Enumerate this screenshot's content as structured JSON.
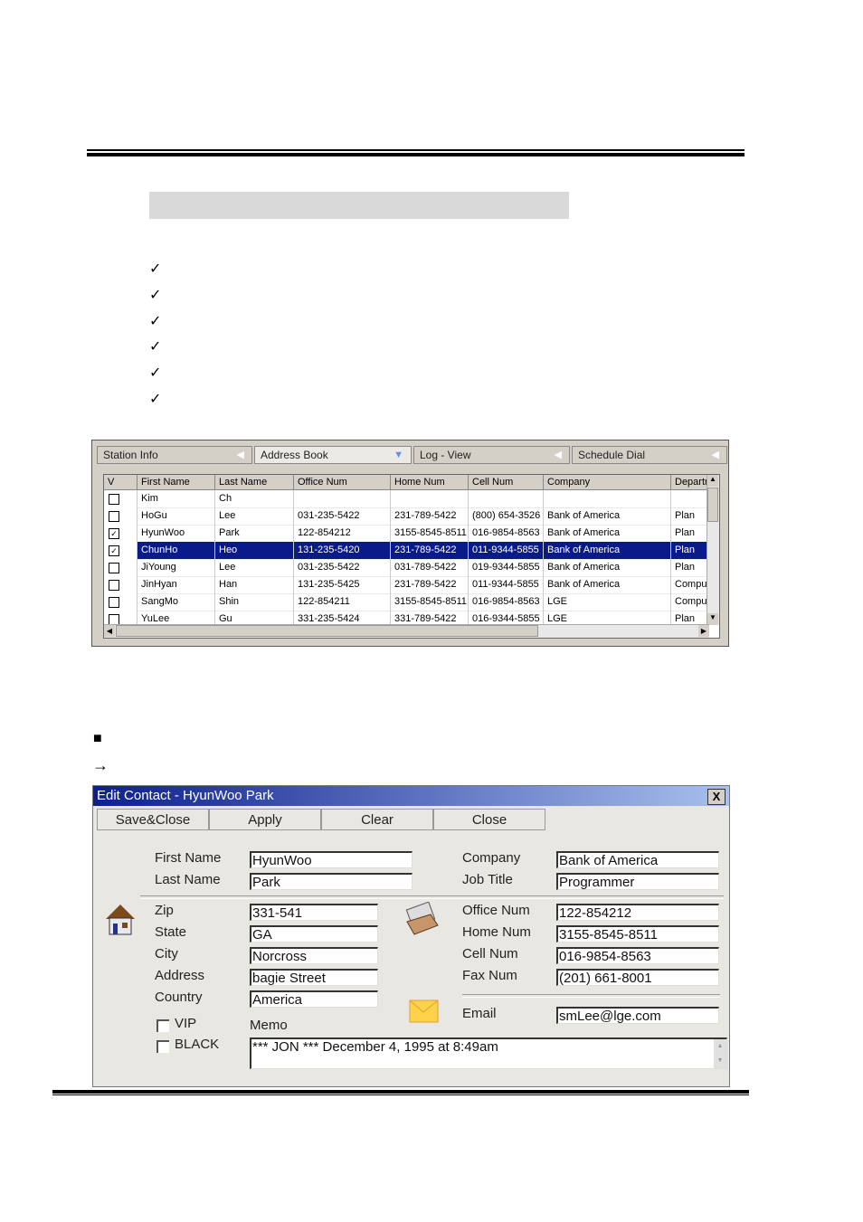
{
  "bullets": {
    "check_count": 6,
    "check_glyph": "✓",
    "square_glyph": "■",
    "arrow_glyph": "→"
  },
  "grid": {
    "tabs": [
      {
        "label": "Station Info"
      },
      {
        "label": "Address Book",
        "active": true
      },
      {
        "label": "Log - View"
      },
      {
        "label": "Schedule Dial"
      }
    ],
    "columns": [
      "V",
      "First Name",
      "Last Name",
      "Office Num",
      "Home Num",
      "Cell Num",
      "Company",
      "Departr"
    ],
    "rows": [
      {
        "checked": false,
        "cells": [
          "Kim",
          "Ch",
          "",
          "",
          "",
          "",
          ""
        ]
      },
      {
        "checked": false,
        "cells": [
          "HoGu",
          "Lee",
          "031-235-5422",
          "231-789-5422",
          "(800) 654-3526",
          "Bank of America",
          "Plan"
        ]
      },
      {
        "checked": true,
        "cells": [
          "HyunWoo",
          "Park",
          "122-854212",
          "3155-8545-8511",
          "016-9854-8563",
          "Bank of America",
          "Plan"
        ]
      },
      {
        "checked": true,
        "selected": true,
        "cells": [
          "ChunHo",
          "Heo",
          "131-235-5420",
          "231-789-5422",
          "011-9344-5855",
          "Bank of America",
          "Plan"
        ]
      },
      {
        "checked": false,
        "cells": [
          "JiYoung",
          "Lee",
          "031-235-5422",
          "031-789-5422",
          "019-9344-5855",
          "Bank of America",
          "Plan"
        ]
      },
      {
        "checked": false,
        "cells": [
          "JinHyan",
          "Han",
          "131-235-5425",
          "231-789-5422",
          "011-9344-5855",
          "Bank of America",
          "Compu"
        ]
      },
      {
        "checked": false,
        "cells": [
          "SangMo",
          "Shin",
          "122-854211",
          "3155-8545-8511",
          "016-9854-8563",
          "LGE",
          "Compu"
        ]
      },
      {
        "checked": false,
        "cells": [
          "YuLee",
          "Gu",
          "331-235-5424",
          "331-789-5422",
          "016-9344-5855",
          "LGE",
          "Plan"
        ]
      }
    ],
    "selection_color": "#0a1a8a"
  },
  "dialog": {
    "title": "Edit Contact - HyunWoo Park",
    "close_glyph": "X",
    "toolbar": [
      "Save&Close",
      "Apply",
      "Clear",
      "Close"
    ],
    "first_name": {
      "label": "First Name",
      "value": "HyunWoo"
    },
    "last_name": {
      "label": "Last Name",
      "value": "Park"
    },
    "company": {
      "label": "Company",
      "value": "Bank of America"
    },
    "job_title": {
      "label": "Job Title",
      "value": "Programmer"
    },
    "zip": {
      "label": "Zip",
      "value": "331-541"
    },
    "state": {
      "label": "State",
      "value": "GA"
    },
    "city": {
      "label": "City",
      "value": "Norcross"
    },
    "address": {
      "label": "Address",
      "value": "bagie Street"
    },
    "country": {
      "label": "Country",
      "value": "America"
    },
    "office": {
      "label": "Office Num",
      "value": "122-854212"
    },
    "home": {
      "label": "Home Num",
      "value": "3155-8545-8511"
    },
    "cell": {
      "label": "Cell Num",
      "value": "016-9854-8563"
    },
    "fax": {
      "label": "Fax Num",
      "value": "(201) 661-8001"
    },
    "email": {
      "label": "Email",
      "value": "smLee@lge.com"
    },
    "vip": {
      "label": "VIP",
      "checked": false
    },
    "black": {
      "label": "BLACK",
      "checked": false
    },
    "memo": {
      "label": "Memo",
      "value": "*** JON ***  December 4, 1995 at  8:49am"
    },
    "icons": [
      "house-icon",
      "card-file-icon",
      "envelope-icon"
    ]
  }
}
